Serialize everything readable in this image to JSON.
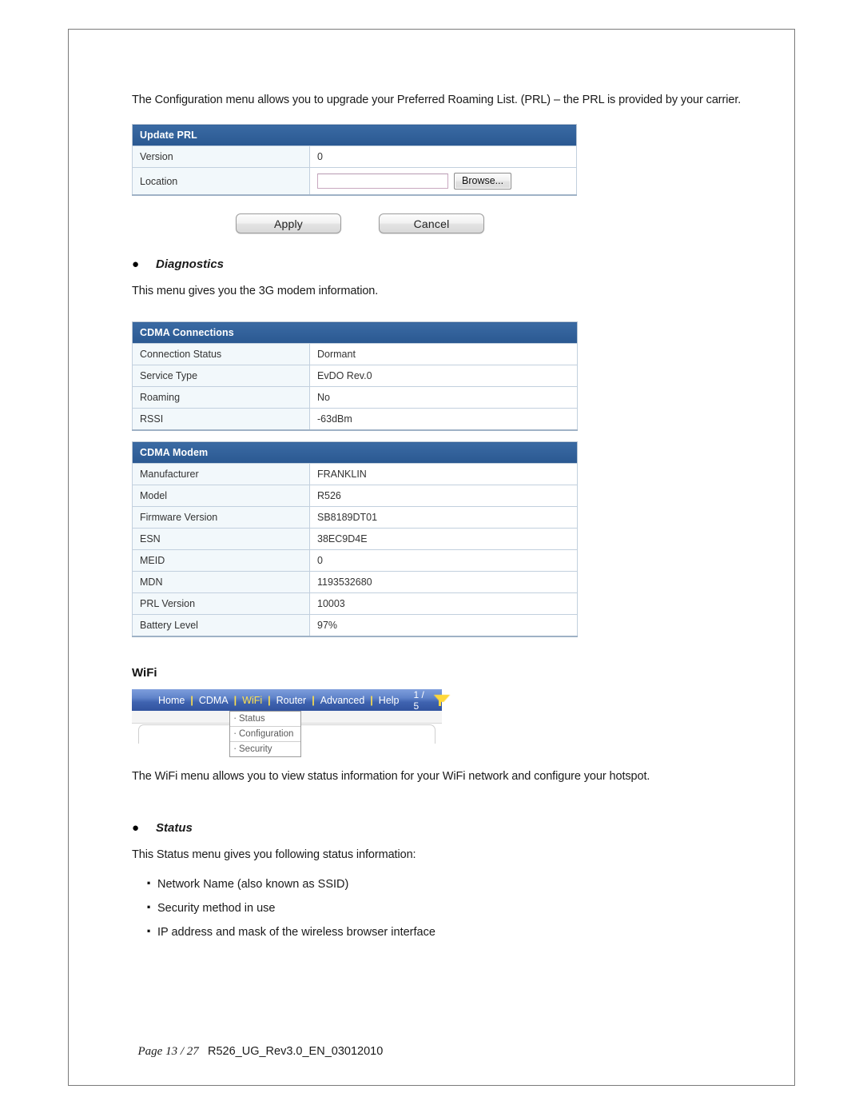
{
  "document": {
    "intro_paragraph": "The Configuration menu allows you to upgrade your Preferred Roaming List. (PRL) – the PRL is provided by your carrier.",
    "footer": {
      "page_label": "Page 13 / 27",
      "doc_id": "R526_UG_Rev3.0_EN_03012010"
    }
  },
  "update_prl": {
    "title": "Update PRL",
    "rows": [
      {
        "label": "Version",
        "value": "0"
      },
      {
        "label": "Location",
        "value": ""
      }
    ],
    "file_input_value": "",
    "browse_label": "Browse...",
    "apply_label": "Apply",
    "cancel_label": "Cancel"
  },
  "diagnostics": {
    "heading": "Diagnostics",
    "bullet": "●",
    "description": "This menu gives you the 3G modem information."
  },
  "cdma_connections": {
    "title": "CDMA Connections",
    "rows": [
      {
        "label": "Connection Status",
        "value": "Dormant"
      },
      {
        "label": "Service Type",
        "value": "EvDO Rev.0"
      },
      {
        "label": "Roaming",
        "value": "No"
      },
      {
        "label": "RSSI",
        "value": "-63dBm"
      }
    ]
  },
  "cdma_modem": {
    "title": "CDMA Modem",
    "rows": [
      {
        "label": "Manufacturer",
        "value": "FRANKLIN"
      },
      {
        "label": "Model",
        "value": "R526"
      },
      {
        "label": "Firmware Version",
        "value": "SB8189DT01"
      },
      {
        "label": "ESN",
        "value": "38EC9D4E"
      },
      {
        "label": "MEID",
        "value": "0"
      },
      {
        "label": "MDN",
        "value": "1193532680"
      },
      {
        "label": "PRL Version",
        "value": "10003"
      },
      {
        "label": "Battery Level",
        "value": "97%"
      }
    ]
  },
  "wifi_section": {
    "heading": "WiFi",
    "nav": {
      "items": [
        {
          "label": "Home",
          "active": false
        },
        {
          "label": "CDMA",
          "active": false
        },
        {
          "label": "WiFi",
          "active": true
        },
        {
          "label": "Router",
          "active": false
        },
        {
          "label": "Advanced",
          "active": false
        },
        {
          "label": "Help",
          "active": false
        }
      ],
      "separator": "|",
      "page_count": "1 / 5",
      "signal_icon": "antenna-icon"
    },
    "dropdown": {
      "items": [
        "Status",
        "Configuration",
        "Security"
      ]
    },
    "description": "The WiFi menu allows you to view status information for your WiFi network and configure your hotspot."
  },
  "status": {
    "heading": "Status",
    "bullet": "●",
    "description": "This Status menu gives you following status information:",
    "items": [
      "Network Name (also known as SSID)",
      "Security method in use",
      "IP address and mask of the wireless browser interface"
    ]
  },
  "colors": {
    "table_header_blue": "#2f5f99",
    "table_label_bg": "#f2f8fb",
    "nav_accent_yellow": "#ffe14d",
    "page_border": "#7a7a7a"
  }
}
